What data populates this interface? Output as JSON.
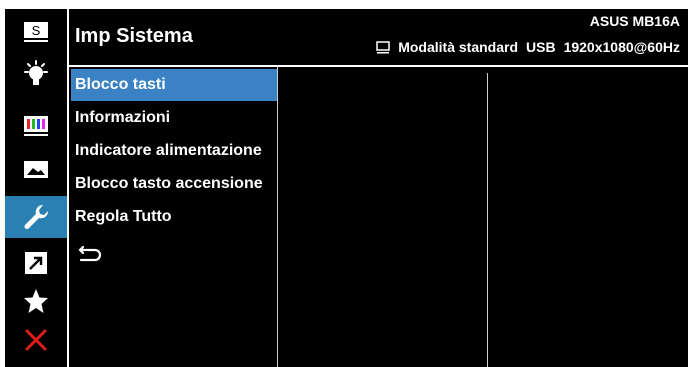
{
  "header": {
    "title": "Imp Sistema",
    "model": "ASUS MB16A",
    "mode": "Modalità standard",
    "input": "USB",
    "resolution": "1920x1080@60Hz"
  },
  "sidebar": {
    "items": [
      {
        "name": "splendid",
        "icon": "s-icon",
        "glyph": "S"
      },
      {
        "name": "blue-light",
        "icon": "bulb-icon"
      },
      {
        "name": "color",
        "icon": "color-bars-icon"
      },
      {
        "name": "image",
        "icon": "image-icon"
      },
      {
        "name": "system-setup",
        "icon": "wrench-icon",
        "selected": true
      },
      {
        "name": "shortcut",
        "icon": "shortcut-arrow-icon"
      },
      {
        "name": "myfavorite",
        "icon": "star-icon"
      },
      {
        "name": "exit",
        "icon": "close-icon"
      }
    ]
  },
  "menu": {
    "items": [
      {
        "label": "Blocco tasti",
        "selected": true
      },
      {
        "label": "Informazioni"
      },
      {
        "label": "Indicatore alimentazione"
      },
      {
        "label": "Blocco tasto accensione"
      },
      {
        "label": "Regola Tutto"
      }
    ],
    "back_icon": "return-icon"
  },
  "colors": {
    "background": "#000000",
    "sidebar_selected": "#2a7fb3",
    "menu_selected": "#3b82c4",
    "exit": "#e21b1b"
  }
}
